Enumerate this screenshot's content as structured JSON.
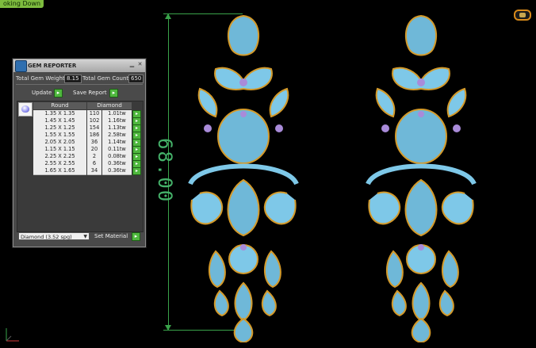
{
  "viewport": {
    "label": "oking Down"
  },
  "dimension": {
    "value": "68.00"
  },
  "panel": {
    "title": "GEM REPORTER",
    "total_weight_label": "Total Gem Weight",
    "total_weight_value": "8.15",
    "total_count_label": "Total Gem Count",
    "total_count_value": "650",
    "update_label": "Update",
    "save_report_label": "Save Report",
    "table": {
      "col_round": "Round",
      "col_diamond": "Diamond",
      "rows": [
        {
          "size": "1.35 X 1.35",
          "count": "110",
          "weight": "1.01tw"
        },
        {
          "size": "1.45 X 1.45",
          "count": "102",
          "weight": "1.16tw"
        },
        {
          "size": "1.25 X 1.25",
          "count": "154",
          "weight": "1.13tw"
        },
        {
          "size": "1.55 X 1.55",
          "count": "186",
          "weight": "2.58tw"
        },
        {
          "size": "2.05 X 2.05",
          "count": "36",
          "weight": "1.14tw"
        },
        {
          "size": "1.15 X 1.15",
          "count": "20",
          "weight": "0.11tw"
        },
        {
          "size": "2.25 X 2.25",
          "count": "2",
          "weight": "0.08tw"
        },
        {
          "size": "2.55 X 2.55",
          "count": "6",
          "weight": "0.36tw"
        },
        {
          "size": "1.65 X 1.65",
          "count": "34",
          "weight": "0.36tw"
        }
      ]
    },
    "material_select": "Diamond (3.52 spg)",
    "set_material_label": "Set Material"
  },
  "colors": {
    "accent_green": "#4fb83e",
    "dimension_green": "#39a34a",
    "gem_blue": "#7ec8e8",
    "metal_gold": "#d49a2a"
  }
}
